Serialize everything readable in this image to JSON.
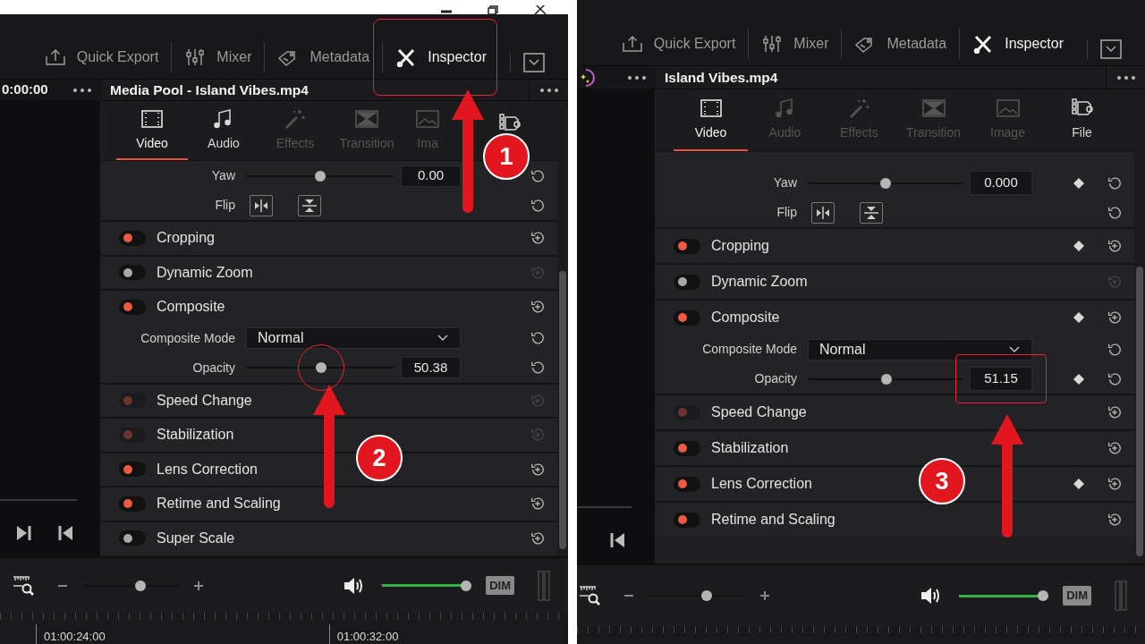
{
  "panels": [
    {
      "window_buttons": true,
      "toolbar": [
        {
          "kind": "export",
          "label": "Quick Export",
          "selected": false,
          "highlighted": false
        },
        {
          "kind": "mixer",
          "label": "Mixer",
          "selected": false,
          "highlighted": false
        },
        {
          "kind": "metadata",
          "label": "Metadata",
          "selected": false,
          "highlighted": false
        },
        {
          "kind": "inspector",
          "label": "Inspector",
          "selected": true,
          "highlighted": true
        }
      ],
      "viewer_header": {
        "kind": "timecode",
        "text": "0:00:00"
      },
      "clip_title": "Media Pool - Island Vibes.mp4",
      "tabs": [
        {
          "kind": "video",
          "label": "Video",
          "selected": true,
          "disabled": false
        },
        {
          "kind": "audio",
          "label": "Audio",
          "selected": false,
          "disabled": false
        },
        {
          "kind": "effects",
          "label": "Effects",
          "selected": false,
          "disabled": true
        },
        {
          "kind": "transition",
          "label": "Transition",
          "selected": false,
          "disabled": true
        },
        {
          "kind": "image",
          "label": "Ima",
          "selected": false,
          "disabled": true
        },
        {
          "kind": "file",
          "selected": false,
          "disabled": false
        }
      ],
      "params": [
        {
          "kind": "slider",
          "label": "Yaw",
          "level": 0.5,
          "value": "0.00"
        },
        {
          "kind": "flip",
          "label": "Flip"
        }
      ],
      "sections": [
        {
          "label": "Cropping",
          "on": true,
          "available": true,
          "reset_enabled": true
        },
        {
          "label": "Dynamic Zoom",
          "on": false,
          "available": true,
          "reset_enabled": false
        },
        {
          "label": "Composite",
          "on": true,
          "available": true,
          "reset_enabled": true,
          "params": [
            {
              "kind": "dropdown",
              "label": "Composite Mode",
              "value": "Normal"
            },
            {
              "kind": "slider",
              "label": "Opacity",
              "level": 0.51,
              "value": "50.38",
              "circled": true
            }
          ]
        },
        {
          "label": "Speed Change",
          "on": true,
          "available": false,
          "reset_enabled": false
        },
        {
          "label": "Stabilization",
          "on": true,
          "available": false,
          "reset_enabled": false
        },
        {
          "label": "Lens Correction",
          "on": true,
          "available": true,
          "reset_enabled": true
        },
        {
          "label": "Retime and Scaling",
          "on": true,
          "available": true,
          "reset_enabled": true
        },
        {
          "label": "Super Scale",
          "on": false,
          "available": true,
          "reset_enabled": true
        }
      ],
      "transport": [
        {
          "kind": "end"
        },
        {
          "kind": "start"
        }
      ],
      "zoom_slider": {
        "level": 0.6
      },
      "volume_slider": {
        "level": 1.0
      },
      "dim_label": "DIM",
      "ruler_labels": [
        "01:00:24:00",
        "01:00:32:00"
      ],
      "callouts": [
        {
          "number": "1"
        },
        {
          "number": "2"
        }
      ]
    },
    {
      "toolbar": [
        {
          "kind": "export",
          "label": "Quick Export",
          "selected": false,
          "highlighted": false
        },
        {
          "kind": "mixer",
          "label": "Mixer",
          "selected": false,
          "highlighted": false
        },
        {
          "kind": "metadata",
          "label": "Metadata",
          "selected": false,
          "highlighted": false
        },
        {
          "kind": "inspector",
          "label": "Inspector",
          "selected": true,
          "highlighted": false
        }
      ],
      "viewer_header": {
        "kind": "effects_icon"
      },
      "clip_title": "Island Vibes.mp4",
      "tabs": [
        {
          "kind": "video",
          "label": "Video",
          "selected": true,
          "disabled": false
        },
        {
          "kind": "audio",
          "label": "Audio",
          "selected": false,
          "disabled": true
        },
        {
          "kind": "effects",
          "label": "Effects",
          "selected": false,
          "disabled": true
        },
        {
          "kind": "transition",
          "label": "Transition",
          "selected": false,
          "disabled": true
        },
        {
          "kind": "image",
          "label": "Image",
          "selected": false,
          "disabled": true
        },
        {
          "kind": "file",
          "label": "File",
          "selected": false,
          "disabled": false
        }
      ],
      "params": [
        {
          "kind": "slider",
          "label": "Yaw",
          "level": 0.5,
          "value": "0.000",
          "keyframe": true
        },
        {
          "kind": "flip",
          "label": "Flip"
        }
      ],
      "sections": [
        {
          "label": "Cropping",
          "on": true,
          "available": true,
          "keyframe": true,
          "reset_enabled": true
        },
        {
          "label": "Dynamic Zoom",
          "on": false,
          "available": true,
          "reset_enabled": false
        },
        {
          "label": "Composite",
          "on": true,
          "available": true,
          "keyframe": true,
          "reset_enabled": true,
          "params": [
            {
              "kind": "dropdown",
              "label": "Composite Mode",
              "value": "Normal"
            },
            {
              "kind": "slider",
              "label": "Opacity",
              "level": 0.51,
              "value": "51.15",
              "keyframe": true,
              "boxed": true
            }
          ]
        },
        {
          "label": "Speed Change",
          "on": true,
          "available": false,
          "reset_enabled": true
        },
        {
          "label": "Stabilization",
          "on": true,
          "available": true,
          "reset_enabled": true
        },
        {
          "label": "Lens Correction",
          "on": true,
          "available": true,
          "keyframe": true,
          "reset_enabled": true
        },
        {
          "label": "Retime and Scaling",
          "on": true,
          "available": true,
          "reset_enabled": true
        }
      ],
      "transport": [
        {
          "kind": "start"
        }
      ],
      "zoom_slider": {
        "level": 0.6
      },
      "volume_slider": {
        "level": 1.0
      },
      "dim_label": "DIM",
      "callouts": [
        {
          "number": "3"
        }
      ]
    }
  ]
}
